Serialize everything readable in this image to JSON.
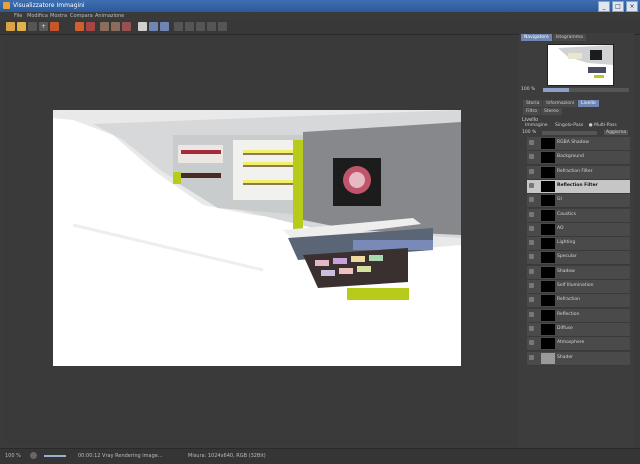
{
  "window": {
    "title": "Visualizzatore Immagini",
    "buttons": [
      "_",
      "□",
      "×"
    ]
  },
  "menu": [
    "File",
    "Modifica",
    "Mostra",
    "Compara",
    "Animazione"
  ],
  "navigator": {
    "tabs": [
      "Navigatore",
      "Istogramma"
    ],
    "zoom": "100 %"
  },
  "info_tabs": {
    "row1": [
      "Storia",
      "Informazioni",
      "Livello"
    ],
    "row2": [
      "Filtro",
      "Stereo"
    ]
  },
  "layers": {
    "section": "Livello",
    "modes": [
      "Immagine",
      "Singolo-Pass",
      "Multi-Pass"
    ],
    "zoom": "100 %",
    "dropdown": "Aggiorna",
    "items": [
      {
        "name": "RGBA Shadow",
        "selected": false
      },
      {
        "name": "Background",
        "selected": false
      },
      {
        "name": "Refraction Filter",
        "selected": false
      },
      {
        "name": "Reflection Filter",
        "selected": true
      },
      {
        "name": "GI",
        "selected": false
      },
      {
        "name": "Caustics",
        "selected": false
      },
      {
        "name": "AO",
        "selected": false
      },
      {
        "name": "Lighting",
        "selected": false
      },
      {
        "name": "Specular",
        "selected": false
      },
      {
        "name": "Shadow",
        "selected": false
      },
      {
        "name": "Self Illumination",
        "selected": false
      },
      {
        "name": "Refraction",
        "selected": false
      },
      {
        "name": "Reflection",
        "selected": false
      },
      {
        "name": "Diffuse",
        "selected": false
      },
      {
        "name": "Atmosphere",
        "selected": false
      },
      {
        "name": "Shader",
        "selected": false
      }
    ]
  },
  "status": {
    "zoom": "100 %",
    "render": "00:00:12  Vray Rendering image...",
    "size": "Misura: 1024x640, RGB (32Bit)"
  }
}
